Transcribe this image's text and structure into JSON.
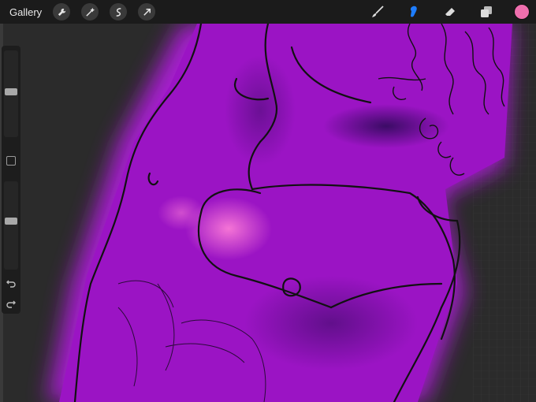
{
  "topbar": {
    "gallery_label": "Gallery",
    "tools_left": [
      "wrench-icon",
      "magic-wand-icon",
      "selection-icon",
      "transform-arrow-icon"
    ],
    "tools_right": [
      "brush-icon",
      "smudge-icon",
      "eraser-icon",
      "layers-icon"
    ],
    "active_tool": "smudge-icon",
    "active_color": "#ef6fae",
    "accent_color": "#1e7dff"
  },
  "sidebar": {
    "brush_size_level": 0.4,
    "opacity_level": 0.45
  },
  "canvas": {
    "figure_color": "#9b14c4",
    "glow_color": "#b41ee0",
    "background_color": "#2b2b2b"
  }
}
